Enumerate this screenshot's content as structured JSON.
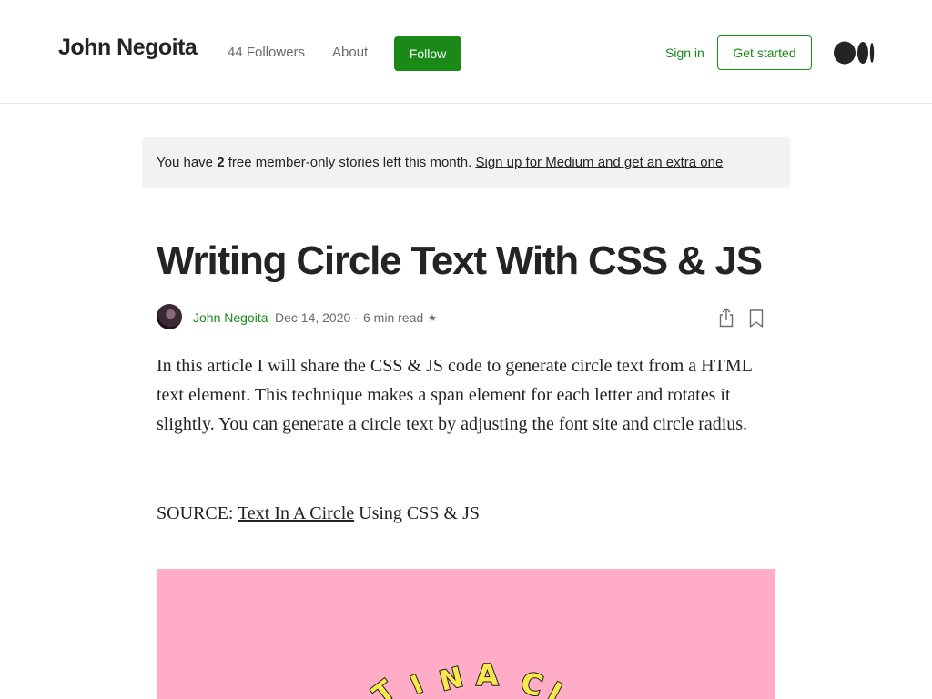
{
  "header": {
    "author_name": "John Negoita",
    "followers_label": "44 Followers",
    "about_label": "About",
    "follow_label": "Follow",
    "signin_label": "Sign in",
    "get_started_label": "Get started",
    "logo_icon": "medium-logo-icon"
  },
  "banner": {
    "prefix": "You have",
    "count": "2",
    "suffix": "free member-only stories left this month.",
    "link": "Sign up for Medium and get an extra one"
  },
  "article": {
    "title": "Writing Circle Text With CSS & JS",
    "author": "John Negoita",
    "date": "Dec 14, 2020",
    "separator": "·",
    "read_time": "6 min read",
    "member_star": "★",
    "share_icon": "share-icon",
    "bookmark_icon": "bookmark-icon",
    "paragraph": "In this article I will share the CSS & JS code to generate circle text from a HTML text element. This technique makes a span element for each letter and rotates it slightly. You can generate a circle text by adjusting the font site and circle radius.",
    "source_prefix": "SOURCE:",
    "source_link": "Text In A Circle",
    "source_suffix": "Using CSS & JS",
    "hero_letters": [
      "T",
      "I",
      "N",
      "A",
      "C",
      "I"
    ]
  },
  "colors": {
    "accent_green": "#1a8917",
    "text": "#242424",
    "muted": "#6b6b6b",
    "banner_bg": "#f2f2f2",
    "hero_pink": "#ffacc7",
    "hero_letter_yellow": "#f7e84b"
  }
}
